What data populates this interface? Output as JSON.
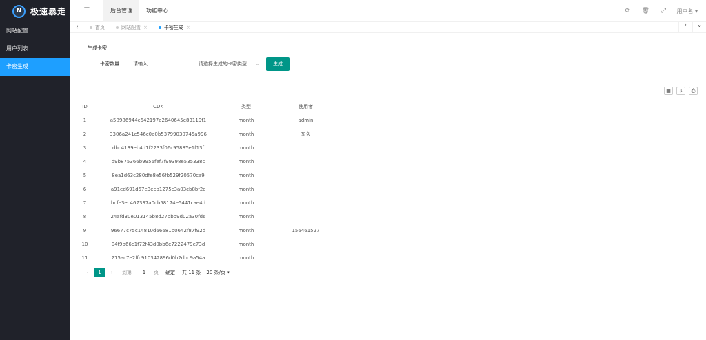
{
  "sidebar": {
    "logo_mark": "N",
    "logo_text": "极速暴走",
    "items": [
      {
        "label": "网站配置"
      },
      {
        "label": "用户列表"
      },
      {
        "label": "卡密生成"
      }
    ]
  },
  "header": {
    "toggle_icon": "menu-fold-icon",
    "tabs": [
      {
        "label": "后台管理"
      },
      {
        "label": "功能中心"
      }
    ],
    "username": "用户名"
  },
  "page_tabs": [
    {
      "label": "首页"
    },
    {
      "label": "网站配置"
    },
    {
      "label": "卡密生成"
    }
  ],
  "form": {
    "title": "生成卡密",
    "count_label": "卡密数量",
    "count_placeholder": "请输入",
    "type_placeholder": "请选择生成的卡密类型",
    "submit_label": "生成"
  },
  "table": {
    "headers": [
      "ID",
      "CDK",
      "类型",
      "使用者"
    ],
    "rows": [
      [
        "1",
        "a58986944c642197a2640645e83119f1",
        "month",
        "admin"
      ],
      [
        "2",
        "3306a241c546c0a0b53799030745a996",
        "month",
        "东久"
      ],
      [
        "3",
        "dbc4139eb4d1f2233f06c95885e1f13f",
        "month",
        ""
      ],
      [
        "4",
        "d9b875366b9956fef7f99398e535338c",
        "month",
        ""
      ],
      [
        "5",
        "8ea1d63c280dfe8e56fb529f20570ca9",
        "month",
        ""
      ],
      [
        "6",
        "a91ed691d57e3ecb1275c3a03cb8bf2c",
        "month",
        ""
      ],
      [
        "7",
        "bcfe3ec467337a0cb58174e5441cae4d",
        "month",
        ""
      ],
      [
        "8",
        "24afd30e013145b8d27bbb9d02a30fd6",
        "month",
        ""
      ],
      [
        "9",
        "96677c75c14810d66681b0642f87f92d",
        "month",
        "156461527"
      ],
      [
        "10",
        "04f9b66c1f72f43d0bb6e7222479e73d",
        "month",
        ""
      ],
      [
        "11",
        "215ac7e2ffc910342896d0b2dbc9a54a",
        "month",
        ""
      ]
    ]
  },
  "pager": {
    "current": "1",
    "to_label": "到第",
    "page_value": "1",
    "page_label": "页",
    "go_label": "确定",
    "total": "共 11 条",
    "page_size": "20 条/页"
  }
}
